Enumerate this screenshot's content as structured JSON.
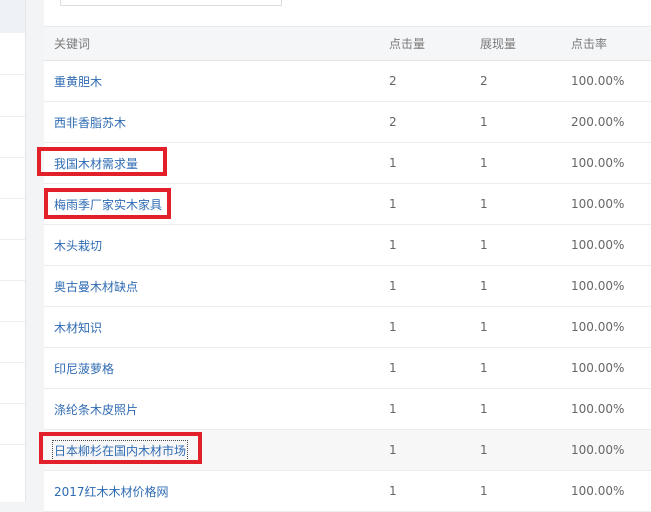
{
  "table": {
    "columns": [
      "关键词",
      "点击量",
      "展现量",
      "点击率"
    ],
    "rows": [
      {
        "keyword": "重黄胆木",
        "clicks": "2",
        "views": "2",
        "rate": "100.00%"
      },
      {
        "keyword": "西非香脂苏木",
        "clicks": "2",
        "views": "1",
        "rate": "200.00%"
      },
      {
        "keyword": "我国木材需求量",
        "clicks": "1",
        "views": "1",
        "rate": "100.00%"
      },
      {
        "keyword": "梅雨季厂家实木家具",
        "clicks": "1",
        "views": "1",
        "rate": "100.00%"
      },
      {
        "keyword": "木头栽切",
        "clicks": "1",
        "views": "1",
        "rate": "100.00%"
      },
      {
        "keyword": "奥古曼木材缺点",
        "clicks": "1",
        "views": "1",
        "rate": "100.00%"
      },
      {
        "keyword": "木材知识",
        "clicks": "1",
        "views": "1",
        "rate": "100.00%"
      },
      {
        "keyword": "印尼菠萝格",
        "clicks": "1",
        "views": "1",
        "rate": "100.00%"
      },
      {
        "keyword": "涤纶条木皮照片",
        "clicks": "1",
        "views": "1",
        "rate": "100.00%"
      },
      {
        "keyword": "日本柳杉在国内木材市场",
        "clicks": "1",
        "views": "1",
        "rate": "100.00%"
      },
      {
        "keyword": "2017红木木材价格网",
        "clicks": "1",
        "views": "1",
        "rate": "100.00%"
      }
    ]
  },
  "colors": {
    "link": "#2f6bb3",
    "highlight": "#e2202a"
  }
}
